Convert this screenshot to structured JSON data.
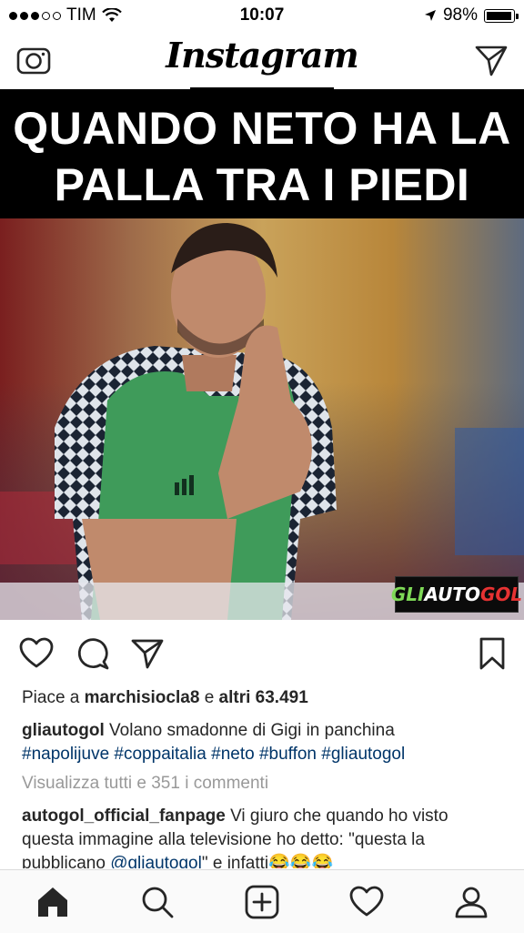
{
  "status": {
    "carrier": "TIM",
    "time": "10:07",
    "battery": "98%",
    "battery_level": 0.98,
    "signal_bars_filled": 3,
    "signal_bars_total": 5
  },
  "header": {
    "title": "Instagram",
    "left_icon": "camera-icon",
    "right_icon": "direct-message-icon"
  },
  "post": {
    "image_text_line1": "QUANDO NETO HA LA",
    "image_text_line2": "PALLA TRA I PIEDI",
    "watermark_gli": "GLI",
    "watermark_auto": "AUTO",
    "watermark_gol": "GOL",
    "likes_prefix": "Piace a",
    "likes_user": "marchisiocla8",
    "likes_conj": "e",
    "likes_others": "altri 63.491",
    "caption_user": "gliautogol",
    "caption_text": "Volano smadonne di Gigi in panchina",
    "hashtags": [
      "#napolijuve",
      "#coppaitalia",
      "#neto",
      "#buffon",
      "#gliautogol"
    ],
    "view_comments": "Visualizza tutti e 351 i commenti",
    "comment_user": "autogol_official_fanpage",
    "comment_text_1": "Vi giuro che quando ho visto questa immagine alla televisione ho detto: \"questa la pubblicano",
    "comment_mention": "@gliautogol",
    "comment_text_2": "\" e infatti😂😂😂"
  },
  "icons": {
    "like": "heart-icon",
    "comment": "comment-icon",
    "share": "share-icon",
    "save": "bookmark-icon"
  },
  "tabs": [
    "home-icon",
    "search-icon",
    "add-post-icon",
    "activity-icon",
    "profile-icon"
  ],
  "colors": {
    "link": "#003569",
    "muted": "#999999",
    "text": "#262626"
  }
}
